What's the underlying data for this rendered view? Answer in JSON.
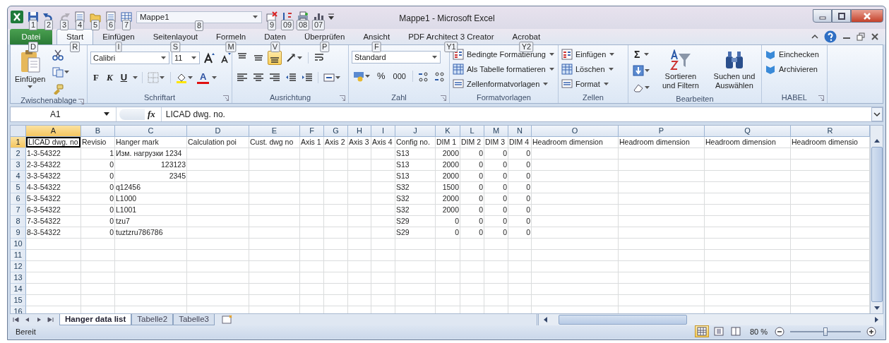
{
  "window": {
    "title": "Mappe1 - Microsoft Excel"
  },
  "quick_access": [
    {
      "kind": "icon",
      "keytip": "1",
      "disabled": false
    },
    {
      "kind": "icon",
      "keytip": "2",
      "disabled": false
    },
    {
      "kind": "icon",
      "keytip": "3",
      "disabled": true
    },
    {
      "kind": "icon",
      "keytip": "4",
      "disabled": false
    },
    {
      "kind": "icon",
      "keytip": "5",
      "disabled": false
    },
    {
      "kind": "icon",
      "keytip": "6",
      "disabled": false
    },
    {
      "kind": "icon",
      "keytip": "7",
      "disabled": false
    },
    {
      "kind": "combo",
      "value": "Mappe1",
      "keytip": "8",
      "disabled": false
    },
    {
      "kind": "icon",
      "keytip": "9",
      "disabled": false
    },
    {
      "kind": "icon",
      "keytip": "09",
      "disabled": false
    },
    {
      "kind": "icon",
      "keytip": "08",
      "disabled": false
    },
    {
      "kind": "icon",
      "keytip": "07",
      "disabled": false
    }
  ],
  "ribbon_tabs": [
    {
      "label": "Datei",
      "keytip": "D",
      "kind": "file",
      "selected": false
    },
    {
      "label": "Start",
      "keytip": "R",
      "kind": "tab",
      "selected": true
    },
    {
      "label": "Einfügen",
      "keytip": "I",
      "kind": "tab",
      "selected": false
    },
    {
      "label": "Seitenlayout",
      "keytip": "S",
      "kind": "tab",
      "selected": false
    },
    {
      "label": "Formeln",
      "keytip": "M",
      "kind": "tab",
      "selected": false
    },
    {
      "label": "Daten",
      "keytip": "V",
      "kind": "tab",
      "selected": false
    },
    {
      "label": "Überprüfen",
      "keytip": "P",
      "kind": "tab",
      "selected": false
    },
    {
      "label": "Ansicht",
      "keytip": "F",
      "kind": "tab",
      "selected": false
    },
    {
      "label": "PDF Architect 3 Creator",
      "keytip": "Y1",
      "kind": "tab",
      "selected": false
    },
    {
      "label": "Acrobat",
      "keytip": "Y2",
      "kind": "tab",
      "selected": false
    }
  ],
  "ribbon_groups": [
    {
      "kind": "clipboard",
      "label": "Zwischenablage",
      "paste_label": "Einfügen",
      "dialog_launcher": true
    },
    {
      "kind": "font",
      "label": "Schriftart",
      "font": "Calibri",
      "size": "11",
      "bold": "F",
      "italic": "K",
      "underline": "U",
      "font_color": "A",
      "dialog_launcher": true
    },
    {
      "kind": "alignment",
      "label": "Ausrichtung",
      "vertical": [
        {
          "selected": false
        },
        {
          "selected": false
        },
        {
          "selected": true
        }
      ],
      "dialog_launcher": true
    },
    {
      "kind": "number",
      "label": "Zahl",
      "format": "Standard",
      "percent": "%",
      "thousands": "000",
      "dialog_launcher": true
    },
    {
      "kind": "list",
      "label": "Formatvorlagen",
      "items": [
        "Bedingte Formatierung",
        "Als Tabelle formatieren",
        "Zellenformatvorlagen"
      ],
      "dialog_launcher": false
    },
    {
      "kind": "list",
      "label": "Zellen",
      "items": [
        "Einfügen",
        "Löschen",
        "Format"
      ],
      "dialog_launcher": false
    },
    {
      "kind": "editing",
      "label": "Bearbeiten",
      "sum": "Σ",
      "sort": "Sortieren und Filtern",
      "find": "Suchen und Auswählen",
      "dialog_launcher": false
    },
    {
      "kind": "plain-list",
      "label": "HABEL",
      "items": [
        "Einchecken",
        "Archivieren"
      ],
      "dialog_launcher": true
    }
  ],
  "formula_bar": {
    "name_box": "A1",
    "function_label": "fx",
    "formula": "LICAD dwg. no."
  },
  "sheet": {
    "columns": [
      {
        "label": "A",
        "selected": true
      },
      {
        "label": "B",
        "selected": false
      },
      {
        "label": "C",
        "selected": false
      },
      {
        "label": "D",
        "selected": false
      },
      {
        "label": "E",
        "selected": false
      },
      {
        "label": "F",
        "selected": false
      },
      {
        "label": "G",
        "selected": false
      },
      {
        "label": "H",
        "selected": false
      },
      {
        "label": "I",
        "selected": false
      },
      {
        "label": "J",
        "selected": false
      },
      {
        "label": "K",
        "selected": false
      },
      {
        "label": "L",
        "selected": false
      },
      {
        "label": "M",
        "selected": false
      },
      {
        "label": "N",
        "selected": false
      },
      {
        "label": "O",
        "selected": false
      },
      {
        "label": "P",
        "selected": false
      },
      {
        "label": "Q",
        "selected": false
      },
      {
        "label": "R",
        "selected": false
      }
    ],
    "rows": [
      {
        "label": "1",
        "selected": true,
        "cells": [
          {
            "text": "LICAD dwg. no",
            "number": false,
            "active": true
          },
          {
            "text": "Revisio",
            "number": false,
            "active": false
          },
          {
            "text": "Hanger mark",
            "number": false,
            "active": false
          },
          {
            "text": "Calculation poi",
            "number": false,
            "active": false
          },
          {
            "text": "Cust. dwg no",
            "number": false,
            "active": false
          },
          {
            "text": "Axis 1",
            "number": false,
            "active": false
          },
          {
            "text": "Axis 2",
            "number": false,
            "active": false
          },
          {
            "text": "Axis 3",
            "number": false,
            "active": false
          },
          {
            "text": "Axis 4",
            "number": false,
            "active": false
          },
          {
            "text": "Config no.",
            "number": false,
            "active": false
          },
          {
            "text": "DIM 1",
            "number": false,
            "active": false
          },
          {
            "text": "DIM 2",
            "number": false,
            "active": false
          },
          {
            "text": "DIM 3",
            "number": false,
            "active": false
          },
          {
            "text": "DIM 4",
            "number": false,
            "active": false
          },
          {
            "text": "Headroom dimension",
            "number": false,
            "active": false
          },
          {
            "text": "Headroom dimension",
            "number": false,
            "active": false
          },
          {
            "text": "Headroom dimension",
            "number": false,
            "active": false
          },
          {
            "text": "Headroom dimensio",
            "number": false,
            "active": false
          }
        ]
      },
      {
        "label": "2",
        "selected": false,
        "cells": [
          {
            "text": "1-3-54322",
            "number": false,
            "active": false
          },
          {
            "text": "1",
            "number": true,
            "active": false
          },
          {
            "text": "Изм. нагрузки 1234",
            "number": false,
            "active": false
          },
          {
            "active": false
          },
          {
            "active": false
          },
          {
            "active": false
          },
          {
            "active": false
          },
          {
            "active": false
          },
          {
            "active": false
          },
          {
            "text": "S13",
            "number": false,
            "active": false
          },
          {
            "text": "2000",
            "number": true,
            "active": false
          },
          {
            "text": "0",
            "number": true,
            "active": false
          },
          {
            "text": "0",
            "number": true,
            "active": false
          },
          {
            "text": "0",
            "number": true,
            "active": false
          }
        ]
      },
      {
        "label": "3",
        "selected": false,
        "cells": [
          {
            "text": "2-3-54322",
            "number": false,
            "active": false
          },
          {
            "text": "0",
            "number": true,
            "active": false
          },
          {
            "text": "123123",
            "number": true,
            "active": false
          },
          {
            "active": false
          },
          {
            "active": false
          },
          {
            "active": false
          },
          {
            "active": false
          },
          {
            "active": false
          },
          {
            "active": false
          },
          {
            "text": "S13",
            "number": false,
            "active": false
          },
          {
            "text": "2000",
            "number": true,
            "active": false
          },
          {
            "text": "0",
            "number": true,
            "active": false
          },
          {
            "text": "0",
            "number": true,
            "active": false
          },
          {
            "text": "0",
            "number": true,
            "active": false
          }
        ]
      },
      {
        "label": "4",
        "selected": false,
        "cells": [
          {
            "text": "3-3-54322",
            "number": false,
            "active": false
          },
          {
            "text": "0",
            "number": true,
            "active": false
          },
          {
            "text": "2345",
            "number": true,
            "active": false
          },
          {
            "active": false
          },
          {
            "active": false
          },
          {
            "active": false
          },
          {
            "active": false
          },
          {
            "active": false
          },
          {
            "active": false
          },
          {
            "text": "S13",
            "number": false,
            "active": false
          },
          {
            "text": "2000",
            "number": true,
            "active": false
          },
          {
            "text": "0",
            "number": true,
            "active": false
          },
          {
            "text": "0",
            "number": true,
            "active": false
          },
          {
            "text": "0",
            "number": true,
            "active": false
          }
        ]
      },
      {
        "label": "5",
        "selected": false,
        "cells": [
          {
            "text": "4-3-54322",
            "number": false,
            "active": false
          },
          {
            "text": "0",
            "number": true,
            "active": false
          },
          {
            "text": "q12456",
            "number": false,
            "active": false
          },
          {
            "active": false
          },
          {
            "active": false
          },
          {
            "active": false
          },
          {
            "active": false
          },
          {
            "active": false
          },
          {
            "active": false
          },
          {
            "text": "S32",
            "number": false,
            "active": false
          },
          {
            "text": "1500",
            "number": true,
            "active": false
          },
          {
            "text": "0",
            "number": true,
            "active": false
          },
          {
            "text": "0",
            "number": true,
            "active": false
          },
          {
            "text": "0",
            "number": true,
            "active": false
          }
        ]
      },
      {
        "label": "6",
        "selected": false,
        "cells": [
          {
            "text": "5-3-54322",
            "number": false,
            "active": false
          },
          {
            "text": "0",
            "number": true,
            "active": false
          },
          {
            "text": "L1000",
            "number": false,
            "active": false
          },
          {
            "active": false
          },
          {
            "active": false
          },
          {
            "active": false
          },
          {
            "active": false
          },
          {
            "active": false
          },
          {
            "active": false
          },
          {
            "text": "S32",
            "number": false,
            "active": false
          },
          {
            "text": "2000",
            "number": true,
            "active": false
          },
          {
            "text": "0",
            "number": true,
            "active": false
          },
          {
            "text": "0",
            "number": true,
            "active": false
          },
          {
            "text": "0",
            "number": true,
            "active": false
          }
        ]
      },
      {
        "label": "7",
        "selected": false,
        "cells": [
          {
            "text": "6-3-54322",
            "number": false,
            "active": false
          },
          {
            "text": "0",
            "number": true,
            "active": false
          },
          {
            "text": "L1001",
            "number": false,
            "active": false
          },
          {
            "active": false
          },
          {
            "active": false
          },
          {
            "active": false
          },
          {
            "active": false
          },
          {
            "active": false
          },
          {
            "active": false
          },
          {
            "text": "S32",
            "number": false,
            "active": false
          },
          {
            "text": "2000",
            "number": true,
            "active": false
          },
          {
            "text": "0",
            "number": true,
            "active": false
          },
          {
            "text": "0",
            "number": true,
            "active": false
          },
          {
            "text": "0",
            "number": true,
            "active": false
          }
        ]
      },
      {
        "label": "8",
        "selected": false,
        "cells": [
          {
            "text": "7-3-54322",
            "number": false,
            "active": false
          },
          {
            "text": "0",
            "number": true,
            "active": false
          },
          {
            "text": "tzu7",
            "number": false,
            "active": false
          },
          {
            "active": false
          },
          {
            "active": false
          },
          {
            "active": false
          },
          {
            "active": false
          },
          {
            "active": false
          },
          {
            "active": false
          },
          {
            "text": "S29",
            "number": false,
            "active": false
          },
          {
            "text": "0",
            "number": true,
            "active": false
          },
          {
            "text": "0",
            "number": true,
            "active": false
          },
          {
            "text": "0",
            "number": true,
            "active": false
          },
          {
            "text": "0",
            "number": true,
            "active": false
          }
        ]
      },
      {
        "label": "9",
        "selected": false,
        "cells": [
          {
            "text": "8-3-54322",
            "number": false,
            "active": false
          },
          {
            "text": "0",
            "number": true,
            "active": false
          },
          {
            "text": "tuztzru786786",
            "number": false,
            "active": false
          },
          {
            "active": false
          },
          {
            "active": false
          },
          {
            "active": false
          },
          {
            "active": false
          },
          {
            "active": false
          },
          {
            "active": false
          },
          {
            "text": "S29",
            "number": false,
            "active": false
          },
          {
            "text": "0",
            "number": true,
            "active": false
          },
          {
            "text": "0",
            "number": true,
            "active": false
          },
          {
            "text": "0",
            "number": true,
            "active": false
          },
          {
            "text": "0",
            "number": true,
            "active": false
          }
        ]
      },
      {
        "label": "10",
        "selected": false
      },
      {
        "label": "11",
        "selected": false
      },
      {
        "label": "12",
        "selected": false
      },
      {
        "label": "13",
        "selected": false
      },
      {
        "label": "14",
        "selected": false
      },
      {
        "label": "15",
        "selected": false
      },
      {
        "label": "16",
        "selected": false
      }
    ]
  },
  "sheet_tabs": [
    {
      "label": "Hanger data list",
      "selected": true
    },
    {
      "label": "Tabelle2",
      "selected": false
    },
    {
      "label": "Tabelle3",
      "selected": false
    }
  ],
  "status_bar": {
    "text": "Bereit",
    "views": [
      {
        "selected": true
      },
      {
        "selected": false
      },
      {
        "selected": false
      }
    ],
    "zoom": "80 %",
    "zoom_slider": {
      "level": 0.5
    }
  }
}
